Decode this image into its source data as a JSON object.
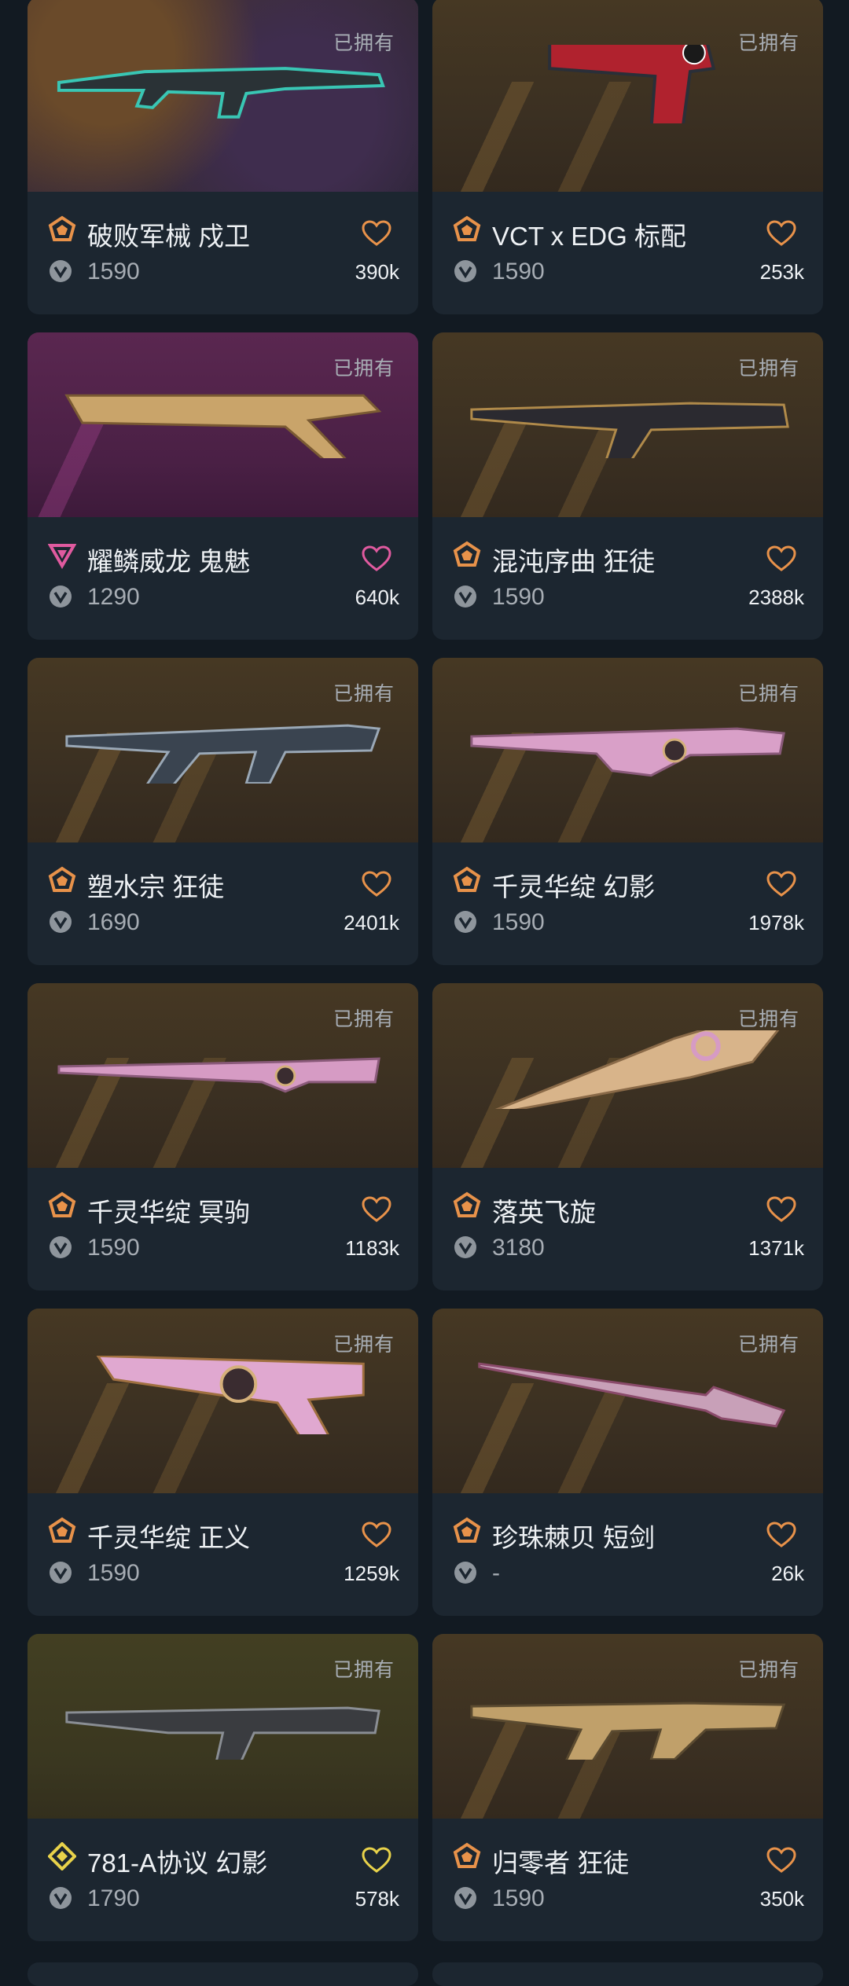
{
  "colors": {
    "background": "#121a22",
    "card": "#1c2630",
    "tier_premium": "#e8924a",
    "tier_exclusive": "#e05a9f",
    "tier_ultra": "#e8d24a"
  },
  "cards": [
    {
      "owned": "已拥有",
      "name": "破败军械 戍卫",
      "price": "1590",
      "count": "390k",
      "tier": "premium-tier-icon",
      "weapon": "rifle-icon"
    },
    {
      "owned": "已拥有",
      "name": "VCT x EDG 标配",
      "price": "1590",
      "count": "253k",
      "tier": "premium-tier-icon",
      "weapon": "pistol-icon"
    },
    {
      "owned": "已拥有",
      "name": "耀鳞威龙 鬼魅",
      "price": "1290",
      "count": "640k",
      "tier": "exclusive-tier-icon",
      "weapon": "pistol-icon"
    },
    {
      "owned": "已拥有",
      "name": "混沌序曲 狂徒",
      "price": "1590",
      "count": "2388k",
      "tier": "premium-tier-icon",
      "weapon": "rifle-icon"
    },
    {
      "owned": "已拥有",
      "name": "塑水宗 狂徒",
      "price": "1690",
      "count": "2401k",
      "tier": "premium-tier-icon",
      "weapon": "rifle-icon"
    },
    {
      "owned": "已拥有",
      "name": "千灵华绽 幻影",
      "price": "1590",
      "count": "1978k",
      "tier": "premium-tier-icon",
      "weapon": "rifle-icon"
    },
    {
      "owned": "已拥有",
      "name": "千灵华绽 冥驹",
      "price": "1590",
      "count": "1183k",
      "tier": "premium-tier-icon",
      "weapon": "sniper-icon"
    },
    {
      "owned": "已拥有",
      "name": "落英飞旋",
      "price": "3180",
      "count": "1371k",
      "tier": "premium-tier-icon",
      "weapon": "knife-icon"
    },
    {
      "owned": "已拥有",
      "name": "千灵华绽 正义",
      "price": "1590",
      "count": "1259k",
      "tier": "premium-tier-icon",
      "weapon": "revolver-icon"
    },
    {
      "owned": "已拥有",
      "name": "珍珠棘贝 短剑",
      "price": "-",
      "count": "26k",
      "tier": "premium-tier-icon",
      "weapon": "dagger-icon"
    },
    {
      "owned": "已拥有",
      "name": "781-A协议 幻影",
      "price": "1790",
      "count": "578k",
      "tier": "ultra-tier-icon",
      "weapon": "rifle-icon"
    },
    {
      "owned": "已拥有",
      "name": "归零者 狂徒",
      "price": "1590",
      "count": "350k",
      "tier": "premium-tier-icon",
      "weapon": "rifle-icon"
    }
  ]
}
